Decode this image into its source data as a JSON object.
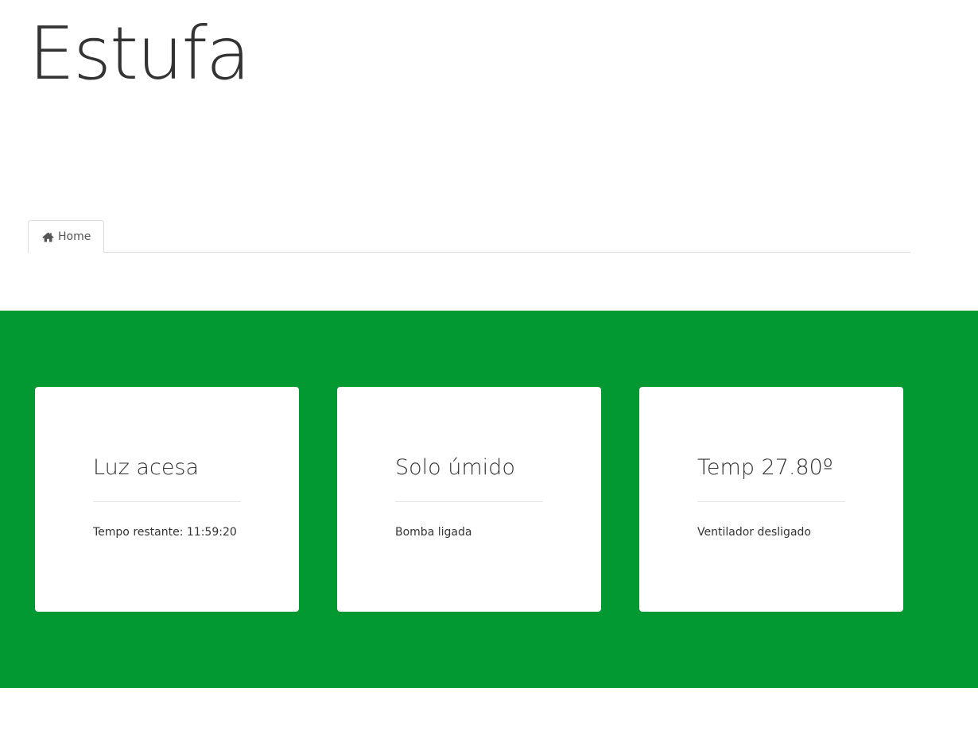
{
  "header": {
    "title": "Estufa"
  },
  "nav": {
    "tabs": [
      {
        "label": "Home",
        "icon": "home-icon",
        "active": true
      }
    ]
  },
  "theme": {
    "band_color": "#029933"
  },
  "cards": [
    {
      "title": "Luz acesa",
      "text": "Tempo restante: 11:59:20"
    },
    {
      "title": "Solo úmido",
      "text": "Bomba ligada"
    },
    {
      "title": "Temp 27.80º",
      "text": "Ventilador desligado"
    }
  ]
}
